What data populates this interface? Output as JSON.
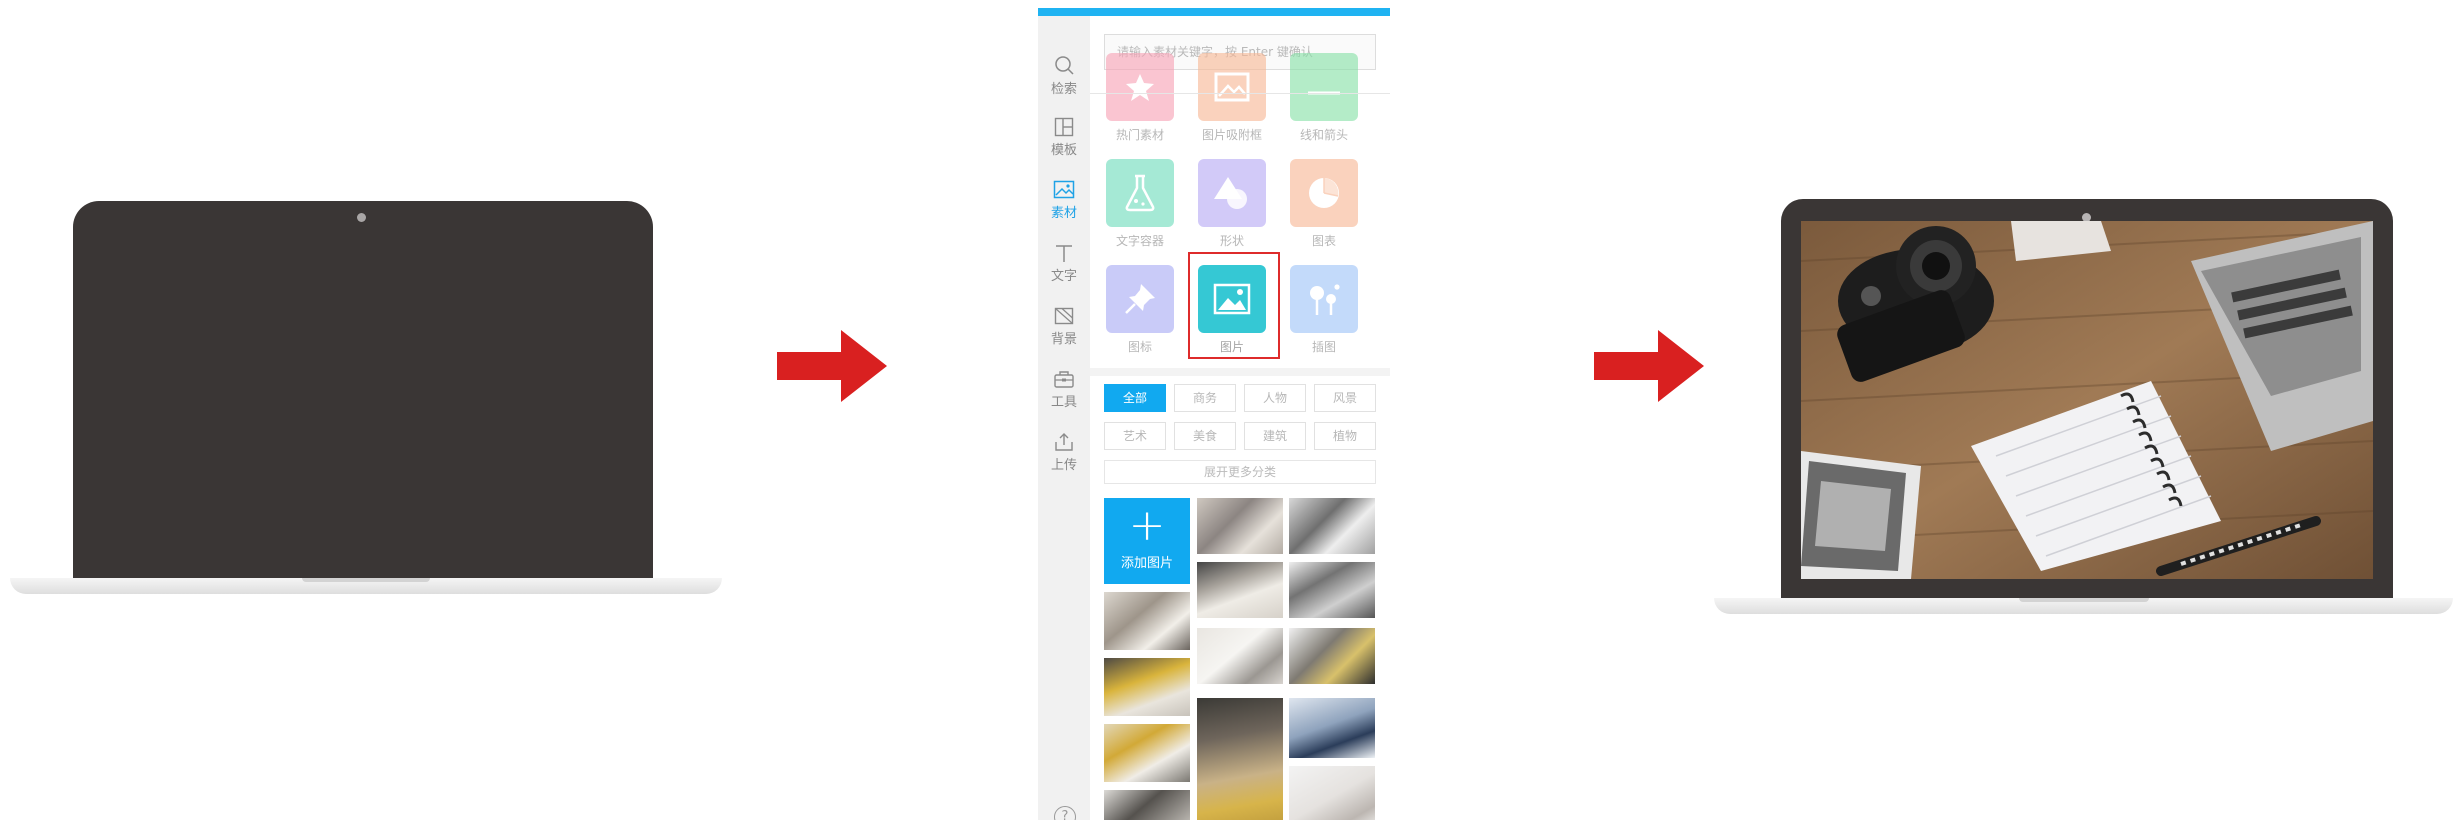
{
  "panel": {
    "accent_color": "#11a9f0",
    "nav": [
      {
        "label": "检索",
        "icon": "search-icon"
      },
      {
        "label": "模板",
        "icon": "template-icon"
      },
      {
        "label": "素材",
        "icon": "image-icon",
        "active": true
      },
      {
        "label": "文字",
        "icon": "text-icon"
      },
      {
        "label": "背景",
        "icon": "background-icon"
      },
      {
        "label": "工具",
        "icon": "toolbox-icon"
      },
      {
        "label": "上传",
        "icon": "upload-icon"
      }
    ],
    "help_label": "?",
    "search_placeholder": "请输入素材关键字，按 Enter 键确认",
    "materials": [
      {
        "label": "热门素材",
        "icon": "star-icon",
        "color": "#f25b7a"
      },
      {
        "label": "图片吸附框",
        "icon": "photo-frame-icon",
        "color": "#f59a6b"
      },
      {
        "label": "线和箭头",
        "icon": "line-arrow-icon",
        "color": "#4cd37a"
      },
      {
        "label": "文字容器",
        "icon": "flask-icon",
        "color": "#4ccfa8"
      },
      {
        "label": "形状",
        "icon": "shapes-icon",
        "color": "#a592f0"
      },
      {
        "label": "图表",
        "icon": "pie-chart-icon",
        "color": "#f59a6b"
      },
      {
        "label": "图标",
        "icon": "pin-icon",
        "color": "#8a8ff0"
      },
      {
        "label": "图片",
        "icon": "picture-icon",
        "color": "#35c8d4",
        "selected": true
      },
      {
        "label": "插图",
        "icon": "tree-icon",
        "color": "#72a8f5"
      }
    ],
    "categories": [
      "全部",
      "商务",
      "人物",
      "风景",
      "艺术",
      "美食",
      "建筑",
      "植物"
    ],
    "active_category": "全部",
    "expand_label": "展开更多分类",
    "add_image_label": "添加图片",
    "add_image_plus": "+"
  }
}
